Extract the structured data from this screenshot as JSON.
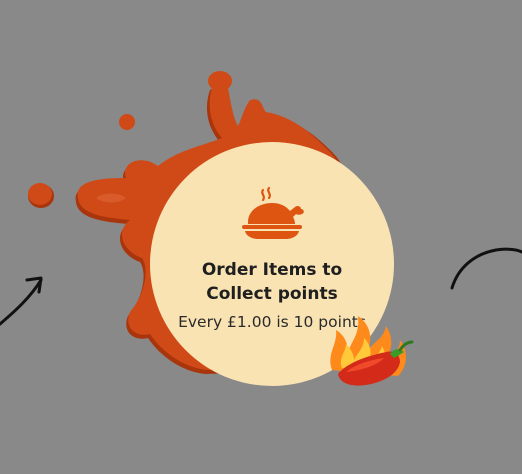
{
  "card": {
    "title": "Order Items to Collect points",
    "subtitle": "Every £1.00 is 10 points"
  },
  "icons": {
    "meal": "roast-chicken-cloche-icon",
    "pepper": "flaming-chili-pepper-icon"
  },
  "colors": {
    "background": "#898989",
    "splash": "#cf4a16",
    "splash_dark": "#a8350c",
    "card": "#f9e3b3",
    "icon": "#dd5511",
    "arrow": "#111111"
  }
}
